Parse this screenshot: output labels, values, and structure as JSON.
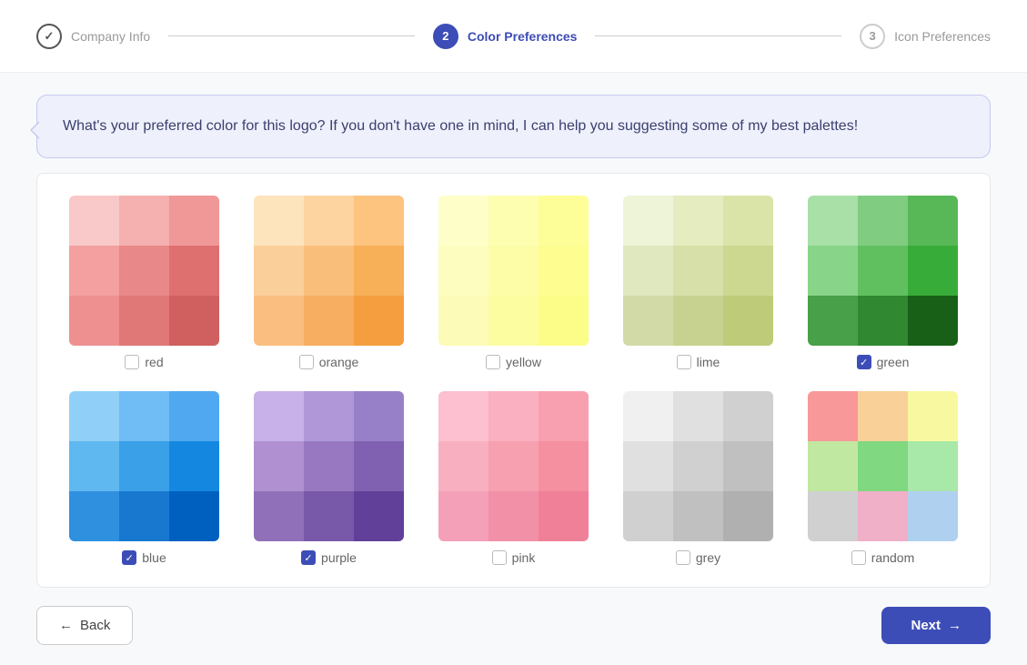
{
  "stepper": {
    "steps": [
      {
        "id": "company-info",
        "number": "✓",
        "label": "Company Info",
        "state": "done"
      },
      {
        "id": "color-preferences",
        "number": "2",
        "label": "Color Preferences",
        "state": "active"
      },
      {
        "id": "icon-preferences",
        "number": "3",
        "label": "Icon Preferences",
        "state": "upcoming"
      }
    ]
  },
  "bubble": {
    "text": "What's your preferred color for this logo? If you don't have one in mind, I can help you suggesting some of my best palettes!"
  },
  "palettes": [
    {
      "id": "red",
      "label": "red",
      "checked": false,
      "colors": [
        "#f9c8c8",
        "#f5b0b0",
        "#f09898",
        "#f4a0a0",
        "#e98888",
        "#de7070",
        "#ee9090",
        "#e07878",
        "#d06060"
      ]
    },
    {
      "id": "orange",
      "label": "orange",
      "checked": false,
      "colors": [
        "#fde4bc",
        "#fdd4a0",
        "#fdc480",
        "#fbcf9a",
        "#f9bf7a",
        "#f7af58",
        "#f9be80",
        "#f7ae60",
        "#f59e40"
      ]
    },
    {
      "id": "yellow",
      "label": "yellow",
      "checked": false,
      "colors": [
        "#fefec8",
        "#fefeb0",
        "#fefe98",
        "#fdfdc0",
        "#fdfda8",
        "#fdfd90",
        "#fcfcb8",
        "#fcfca0",
        "#fcfc88"
      ]
    },
    {
      "id": "lime",
      "label": "lime",
      "checked": false,
      "colors": [
        "#eef4d8",
        "#e4ecc0",
        "#dae4a8",
        "#e0e8c0",
        "#d6e0a8",
        "#ccd890",
        "#d2daa8",
        "#c8d290",
        "#becb78"
      ]
    },
    {
      "id": "green",
      "label": "green",
      "checked": true,
      "colors": [
        "#a8e0a8",
        "#80cc80",
        "#58b858",
        "#88d488",
        "#60c060",
        "#38ac38",
        "#48a048",
        "#308830",
        "#186018"
      ]
    },
    {
      "id": "blue",
      "label": "blue",
      "checked": true,
      "colors": [
        "#90d0f8",
        "#70bcf4",
        "#50a8f0",
        "#60b8f0",
        "#3aa0e8",
        "#1488e0",
        "#3090e0",
        "#1878d0",
        "#0060c0"
      ]
    },
    {
      "id": "purple",
      "label": "purple",
      "checked": true,
      "colors": [
        "#c8b0e8",
        "#b098d8",
        "#9880c8",
        "#b090d0",
        "#9878c0",
        "#8060b0",
        "#9070b8",
        "#7858a8",
        "#604098"
      ]
    },
    {
      "id": "pink",
      "label": "pink",
      "checked": false,
      "colors": [
        "#fcc0d0",
        "#fab0c0",
        "#f8a0b0",
        "#f8b0c0",
        "#f6a0b0",
        "#f490a0",
        "#f4a0b8",
        "#f290a8",
        "#f08098"
      ]
    },
    {
      "id": "grey",
      "label": "grey",
      "checked": false,
      "colors": [
        "#f0f0f0",
        "#e0e0e0",
        "#d0d0d0",
        "#e0e0e0",
        "#d0d0d0",
        "#c0c0c0",
        "#d0d0d0",
        "#c0c0c0",
        "#b0b0b0"
      ]
    },
    {
      "id": "random",
      "label": "random",
      "checked": false,
      "colors": [
        "#f89898",
        "#f8d098",
        "#f8f8a0",
        "#c0e8a0",
        "#80d880",
        "#a8e8a8",
        "#d0d0d0",
        "#f0b0c8",
        "#b0d0f0"
      ]
    }
  ],
  "footer": {
    "back_label": "Back",
    "next_label": "Next",
    "back_arrow": "←",
    "next_arrow": "→"
  }
}
